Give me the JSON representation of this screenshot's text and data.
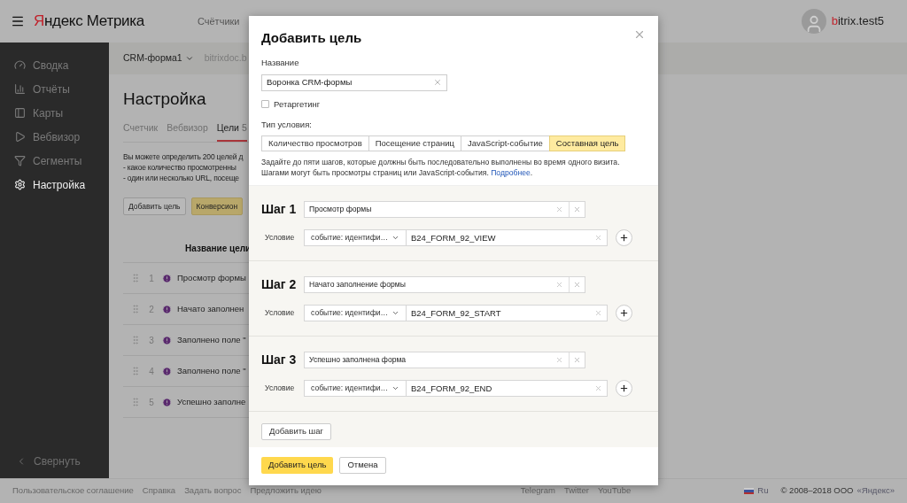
{
  "header": {
    "logo": "Яндекс Метрика",
    "nav": [
      "Счётчики"
    ],
    "user": "bitrix.test5"
  },
  "sidebar": {
    "items": [
      {
        "label": "Сводка",
        "selected": false
      },
      {
        "label": "Отчёты",
        "selected": false
      },
      {
        "label": "Карты",
        "selected": false
      },
      {
        "label": "Вебвизор",
        "selected": false
      },
      {
        "label": "Сегменты",
        "selected": false
      },
      {
        "label": "Настройка",
        "selected": true
      }
    ],
    "collapse": "Свернуть"
  },
  "counter": {
    "name": "CRM-форма1",
    "site": "bitrixdoc.b"
  },
  "page": {
    "title": "Настройка",
    "tabs": [
      {
        "label": "Счетчик",
        "selected": false
      },
      {
        "label": "Вебвизор",
        "selected": false
      },
      {
        "label": "Цели",
        "count": "5",
        "selected": true
      }
    ],
    "intro": [
      "Вы можете определить 200 целей д",
      "- какое количество просмотренны",
      "- один или несколько URL, посеще"
    ],
    "buttons": [
      {
        "label": "Добавить цель",
        "primary": false
      },
      {
        "label": "Конверсион",
        "primary": true
      }
    ],
    "table": {
      "column": "Название цели",
      "rows": [
        {
          "num": "1",
          "name": "Просмотр формы"
        },
        {
          "num": "2",
          "name": "Начато заполнен"
        },
        {
          "num": "3",
          "name": "Заполнено поле \""
        },
        {
          "num": "4",
          "name": "Заполнено поле \""
        },
        {
          "num": "5",
          "name": "Успешно заполне"
        }
      ]
    }
  },
  "footer": {
    "links": [
      "Пользовательское соглашение",
      "Справка",
      "Задать вопрос",
      "Предложить идею"
    ],
    "social": [
      "Telegram",
      "Twitter",
      "YouTube"
    ],
    "lang": "Ru",
    "copyright": "© 2008–2018 ООО",
    "company": "«Яндекс»"
  },
  "modal": {
    "title": "Добавить цель",
    "name_label": "Название",
    "name_value": "Воронка CRM-формы",
    "retargeting": {
      "label": "Ретаргетинг",
      "checked": false
    },
    "type_label": "Тип условия:",
    "types": [
      {
        "label": "Количество просмотров",
        "selected": false
      },
      {
        "label": "Посещение страниц",
        "selected": false
      },
      {
        "label": "JavaScript-событие",
        "selected": false
      },
      {
        "label": "Составная цель",
        "selected": true
      }
    ],
    "help": {
      "text": "Задайте до пяти шагов, которые должны быть последовательно выполнены во время одного визита. Шагами могут быть просмотры страниц или JavaScript-события.",
      "link": "Подробнее",
      "suffix": "."
    },
    "steps": [
      {
        "title": "Шаг 1",
        "name": "Просмотр формы",
        "condition_label": "Условие",
        "condition_type": "событие: идентифи…",
        "value": "B24_FORM_92_VIEW"
      },
      {
        "title": "Шаг 2",
        "name": "Начато заполнение формы",
        "condition_label": "Условие",
        "condition_type": "событие: идентифи…",
        "value": "B24_FORM_92_START"
      },
      {
        "title": "Шаг 3",
        "name": "Успешно заполнена форма",
        "condition_label": "Условие",
        "condition_type": "событие: идентифи…",
        "value": "B24_FORM_92_END"
      }
    ],
    "add_step": "Добавить шаг",
    "submit": "Добавить цель",
    "cancel": "Отмена"
  }
}
